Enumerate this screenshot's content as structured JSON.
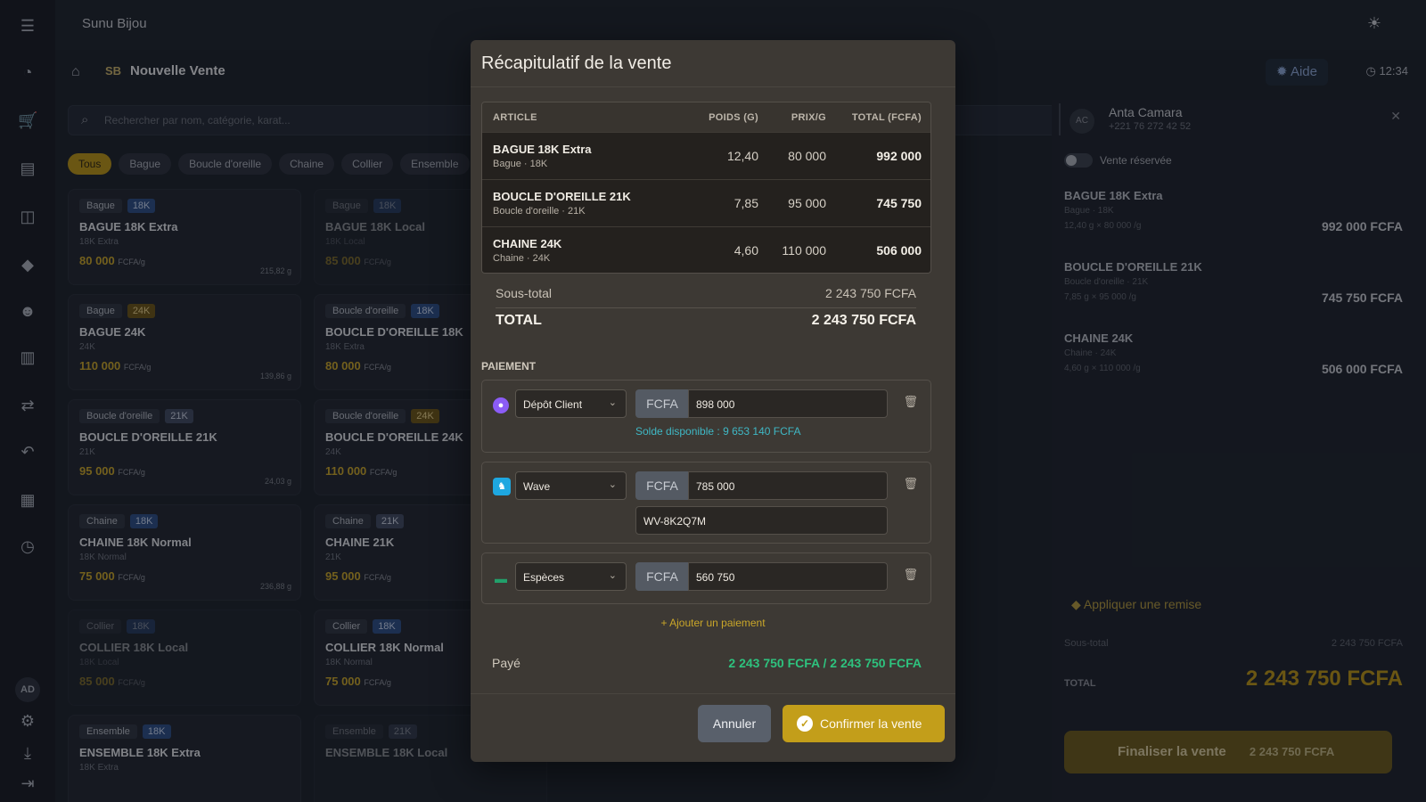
{
  "app": {
    "title": "Sunu Bijou",
    "breadcrumb_badge": "SB",
    "page_title": "Nouvelle Vente",
    "help_label": "Aide",
    "time": "12:34",
    "user_initials": "AD"
  },
  "search": {
    "placeholder": "Rechercher par nom, catégorie, karat..."
  },
  "filters": [
    "Tous",
    "Bague",
    "Boucle d'oreille",
    "Chaine",
    "Collier",
    "Ensemble"
  ],
  "products": [
    {
      "cat": "Bague",
      "karat": "18K",
      "name": "BAGUE 18K Extra",
      "sub": "18K Extra",
      "price": "80 000",
      "unit": "FCFA/g",
      "stock": "215,82 g"
    },
    {
      "cat": "Bague",
      "karat": "24K",
      "name": "BAGUE 24K",
      "sub": "24K",
      "price": "110 000",
      "unit": "FCFA/g",
      "stock": "139,86 g"
    },
    {
      "cat": "Boucle d'oreille",
      "karat": "21K",
      "name": "BOUCLE D'OREILLE 21K",
      "sub": "21K",
      "price": "95 000",
      "unit": "FCFA/g",
      "stock": "24,03 g"
    },
    {
      "cat": "Chaine",
      "karat": "18K",
      "name": "CHAINE 18K Normal",
      "sub": "18K Normal",
      "price": "75 000",
      "unit": "FCFA/g",
      "stock": "236,88 g"
    },
    {
      "cat": "Collier",
      "karat": "18K",
      "name": "COLLIER 18K Local",
      "sub": "18K Local",
      "price": "85 000",
      "unit": "FCFA/g",
      "stock": ""
    },
    {
      "cat": "Ensemble",
      "karat": "18K",
      "name": "ENSEMBLE 18K Extra",
      "sub": "18K Extra",
      "price": "",
      "unit": "",
      "stock": ""
    },
    {
      "cat": "Bague",
      "karat": "18K",
      "name": "BAGUE 18K Local",
      "sub": "18K Local",
      "price": "85 000",
      "unit": "FCFA/g",
      "stock": ""
    },
    {
      "cat": "Boucle d'oreille",
      "karat": "18K",
      "name": "BOUCLE D'OREILLE 18K",
      "sub": "18K Extra",
      "price": "80 000",
      "unit": "FCFA/g",
      "stock": ""
    },
    {
      "cat": "Boucle d'oreille",
      "karat": "24K",
      "name": "BOUCLE D'OREILLE 24K",
      "sub": "24K",
      "price": "110 000",
      "unit": "FCFA/g",
      "stock": ""
    },
    {
      "cat": "Chaine",
      "karat": "21K",
      "name": "CHAINE 21K",
      "sub": "21K",
      "price": "95 000",
      "unit": "FCFA/g",
      "stock": ""
    },
    {
      "cat": "Collier",
      "karat": "18K",
      "name": "COLLIER 18K Normal",
      "sub": "18K Normal",
      "price": "75 000",
      "unit": "FCFA/g",
      "stock": ""
    },
    {
      "cat": "Ensemble",
      "karat": "21K",
      "name": "ENSEMBLE 18K Local",
      "sub": "",
      "price": "",
      "unit": "",
      "stock": ""
    }
  ],
  "customer": {
    "initials": "AC",
    "name": "Anta Camara",
    "phone": "+221 76 272 42 52",
    "reserved_label": "Vente réservée"
  },
  "cart": {
    "items": [
      {
        "name": "BAGUE 18K Extra",
        "sub": "Bague · 18K",
        "detail": "12,40 g × 80 000 /g",
        "amount": "992 000 FCFA"
      },
      {
        "name": "BOUCLE D'OREILLE 21K",
        "sub": "Boucle d'oreille · 21K",
        "detail": "7,85 g × 95 000 /g",
        "amount": "745 750 FCFA"
      },
      {
        "name": "CHAINE 24K",
        "sub": "Chaine · 24K",
        "detail": "4,60 g × 110 000 /g",
        "amount": "506 000 FCFA"
      }
    ],
    "discount_label": "Appliquer une remise",
    "subtotal_label": "Sous-total",
    "subtotal": "2 243 750 FCFA",
    "total_label": "TOTAL",
    "total": "2 243 750 FCFA",
    "finalize_label": "Finaliser la vente",
    "finalize_amount": "2 243 750 FCFA"
  },
  "modal": {
    "title": "Récapitulatif de la vente",
    "columns": [
      "ARTICLE",
      "POIDS (G)",
      "PRIX/G",
      "TOTAL (FCFA)"
    ],
    "rows": [
      {
        "name": "BAGUE 18K Extra",
        "sub": "Bague · 18K",
        "weight": "12,40",
        "price": "80 000",
        "total": "992 000"
      },
      {
        "name": "BOUCLE D'OREILLE 21K",
        "sub": "Boucle d'oreille · 21K",
        "weight": "7,85",
        "price": "95 000",
        "total": "745 750"
      },
      {
        "name": "CHAINE 24K",
        "sub": "Chaine · 24K",
        "weight": "4,60",
        "price": "110 000",
        "total": "506 000"
      }
    ],
    "subtotal_label": "Sous-total",
    "subtotal": "2 243 750 FCFA",
    "total_label": "TOTAL",
    "total": "2 243 750 FCFA",
    "payment_label": "PAIEMENT",
    "payments": [
      {
        "method": "Dépôt Client",
        "currency": "FCFA",
        "amount": "898 000",
        "balance": "Solde disponible : 9 653 140 FCFA",
        "icon": "user-icon"
      },
      {
        "method": "Wave",
        "currency": "FCFA",
        "amount": "785 000",
        "reference": "WV-8K2Q7M",
        "icon": "wave-icon"
      },
      {
        "method": "Espèces",
        "currency": "FCFA",
        "amount": "560 750",
        "icon": "cash-icon"
      }
    ],
    "add_payment_label": "Ajouter un paiement",
    "paid_label": "Payé",
    "paid_value": "2 243 750 FCFA / 2 243 750 FCFA",
    "cancel_label": "Annuler",
    "confirm_label": "Confirmer la vente"
  },
  "colors": {
    "accent": "#c39e1a",
    "success": "#2ec27e",
    "info": "#3fb8c5",
    "modal_bg": "#3d3934"
  }
}
